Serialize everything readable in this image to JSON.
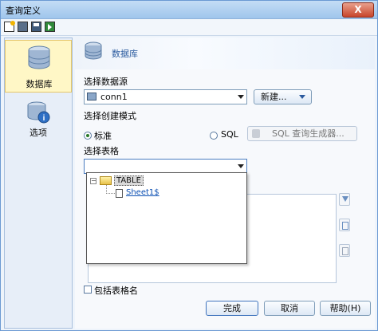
{
  "window": {
    "title": "查询定义",
    "close_label": "X"
  },
  "toolbar": {
    "icons": [
      "new-icon",
      "open-icon",
      "save-icon",
      "run-icon"
    ]
  },
  "nav": [
    {
      "label": "数据库",
      "icon": "database-icon",
      "selected": true
    },
    {
      "label": "选项",
      "icon": "options-icon",
      "selected": false
    }
  ],
  "header": {
    "title": "数据库"
  },
  "datasource": {
    "label": "选择数据源",
    "value": "conn1",
    "new_button": "新建..."
  },
  "mode": {
    "label": "选择创建模式",
    "standard": "标准",
    "sql": "SQL",
    "sql_builder": "SQL 查询生成器...",
    "selected": "标准"
  },
  "table": {
    "label": "选择表格",
    "value": "",
    "tree_root": "TABLE",
    "tree_child": "Sheet1$"
  },
  "include_table_name": {
    "label": "包括表格名",
    "checked": false
  },
  "footer": {
    "finish": "完成",
    "cancel": "取消",
    "help": "帮助(H)"
  },
  "colors": {
    "accent": "#2a5a9e",
    "selected_nav": "#fff7c6"
  }
}
